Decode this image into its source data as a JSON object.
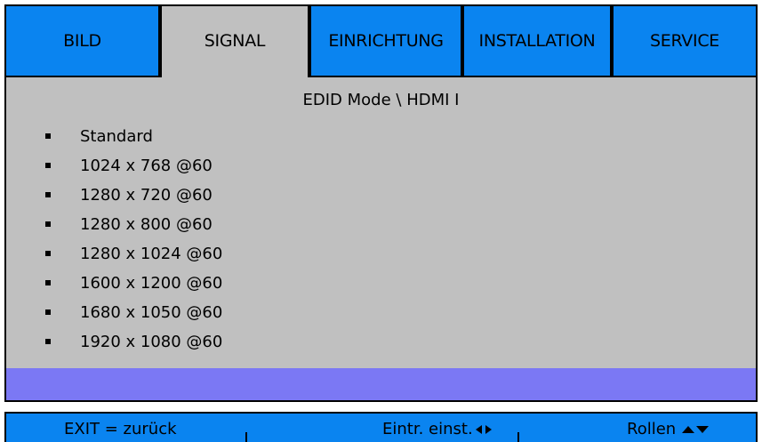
{
  "tabs": [
    {
      "label": "BILD",
      "active": false
    },
    {
      "label": "SIGNAL",
      "active": true
    },
    {
      "label": "EINRICHTUNG",
      "active": false
    },
    {
      "label": "INSTALLATION",
      "active": false
    },
    {
      "label": "SERVICE",
      "active": false
    }
  ],
  "panel": {
    "title": "EDID Mode \\ HDMI I",
    "options": [
      "Standard",
      "1024 x 768 @60",
      "1280 x 720 @60",
      "1280 x 800 @60",
      "1280 x 1024 @60",
      "1600 x 1200 @60",
      "1680 x 1050 @60",
      "1920 x 1080 @60"
    ]
  },
  "footer": {
    "exit": "EXIT = zurück",
    "separator": "|",
    "set": "Eintr. einst.",
    "scroll": "Rollen"
  },
  "colors": {
    "tab_blue": "#0a84f0",
    "tab_active": "#c0c0c0",
    "panel_bg": "#c0c0c0",
    "selection": "#7b78f4"
  }
}
